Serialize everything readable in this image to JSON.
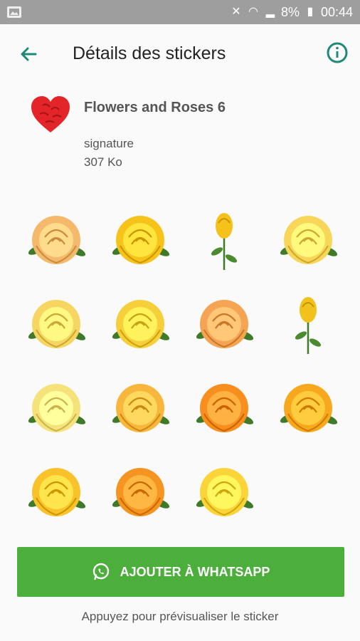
{
  "status_bar": {
    "battery": "8%",
    "time": "00:44"
  },
  "app_bar": {
    "title": "Détails des stickers"
  },
  "pack": {
    "name": "Flowers and Roses  6",
    "author": "signature",
    "size": "307 Ko"
  },
  "stickers": [
    {
      "name": "peach-rose-cluster",
      "color": "#f4b96a"
    },
    {
      "name": "yellow-rose-leaves",
      "color": "#f7c21a"
    },
    {
      "name": "yellow-rosebud-stem",
      "color": "#f5c21c"
    },
    {
      "name": "yellow-rose-pale",
      "color": "#f8d65a"
    },
    {
      "name": "yellow-rose-large",
      "color": "#f6d560"
    },
    {
      "name": "yellow-rose-with-leaves",
      "color": "#f6cf3a"
    },
    {
      "name": "orange-rose-soft",
      "color": "#f5a454"
    },
    {
      "name": "yellow-rosebud-long-stem",
      "color": "#f0c21b"
    },
    {
      "name": "yellow-rose-bouquet",
      "color": "#f6e27a"
    },
    {
      "name": "orange-yellow-rose",
      "color": "#f8b63c"
    },
    {
      "name": "orange-rose-leaves",
      "color": "#f88e1e"
    },
    {
      "name": "golden-rose",
      "color": "#f8a81c"
    },
    {
      "name": "yellow-rose-side",
      "color": "#f9c22a"
    },
    {
      "name": "orange-rose-deep",
      "color": "#f59420"
    },
    {
      "name": "yellow-rose-bright",
      "color": "#fbd43a"
    }
  ],
  "add_button": {
    "label": "AJOUTER À WHATSAPP"
  },
  "hint": "Appuyez pour prévisualiser le sticker",
  "colors": {
    "accent": "#1f8a78",
    "button": "#4caf3c",
    "heart": "#e3252a"
  }
}
